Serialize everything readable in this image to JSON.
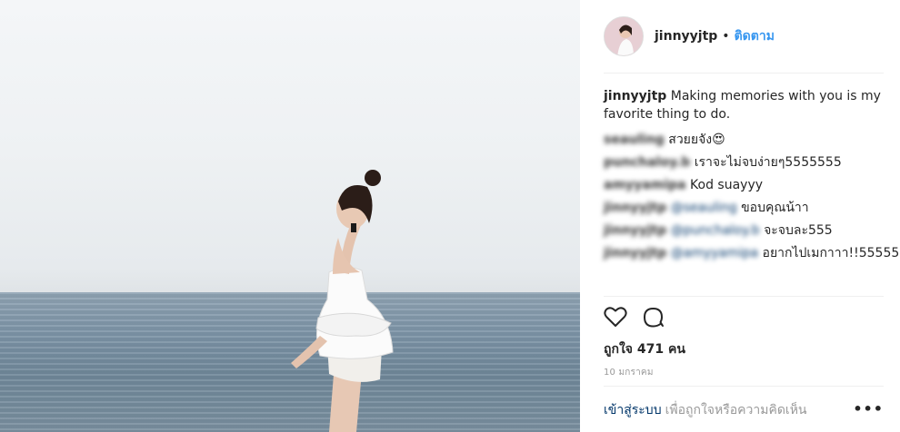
{
  "post": {
    "username": "jinnyyjtp",
    "separator": "•",
    "follow_label": "ติดตาม"
  },
  "caption": {
    "username": "jinnyyjtp",
    "text": " Making memories with you is my favorite thing to do."
  },
  "comments": [
    {
      "user": "seauling",
      "mention": "",
      "text": " สวยยจัง😍"
    },
    {
      "user": "punchaloy.b",
      "mention": "",
      "text": " เราจะไม่จบง่ายๆ5555555"
    },
    {
      "user": "amyyamipa",
      "mention": "",
      "text": " Kod suayyy"
    },
    {
      "user": "jinnyyjtp",
      "mention": " @seauling",
      "text": " ขอบคุณน้าา"
    },
    {
      "user": "jinnyyjtp",
      "mention": " @punchaloy.b",
      "text": " จะจบละ555"
    },
    {
      "user": "jinnyyjtp",
      "mention": " @amyyamipa",
      "text": " อยากไปเมกาาา!!55555"
    }
  ],
  "likes": "ถูกใจ 471 คน",
  "date": "10 มกราคม",
  "footer": {
    "login": "เข้าสู่ระบบ",
    "rest": "เพื่อถูกใจหรือความคิดเห็น",
    "more": "•••"
  },
  "icons": {
    "like": "heart-icon",
    "comment": "comment-bubble-icon",
    "more": "more-options-icon"
  },
  "colors": {
    "link_blue": "#3897f0",
    "mention_blue": "#003569",
    "meta_gray": "#999999"
  }
}
